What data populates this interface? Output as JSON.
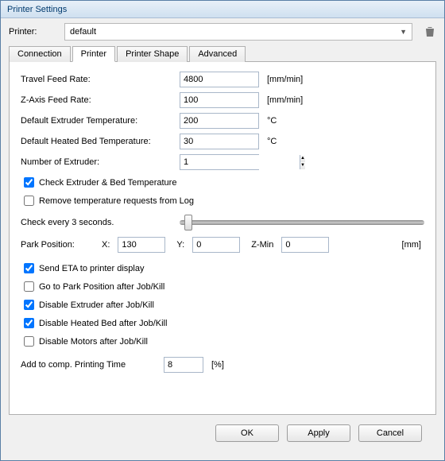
{
  "window": {
    "title": "Printer Settings"
  },
  "header": {
    "printer_label": "Printer:",
    "printer_value": "default"
  },
  "tabs": {
    "items": [
      {
        "label": "Connection"
      },
      {
        "label": "Printer"
      },
      {
        "label": "Printer Shape"
      },
      {
        "label": "Advanced"
      }
    ],
    "active_index": 1
  },
  "fields": {
    "travel_feed_rate": {
      "label": "Travel Feed Rate:",
      "value": "4800",
      "unit": "[mm/min]"
    },
    "z_axis_feed_rate": {
      "label": "Z-Axis Feed Rate:",
      "value": "100",
      "unit": "[mm/min]"
    },
    "default_extruder_temp": {
      "label": "Default Extruder Temperature:",
      "value": "200",
      "unit": "°C"
    },
    "default_bed_temp": {
      "label": "Default Heated Bed Temperature:",
      "value": "30",
      "unit": "°C"
    },
    "num_extruder": {
      "label": "Number of Extruder:",
      "value": "1"
    }
  },
  "checks": {
    "check_temp": {
      "label": "Check Extruder & Bed Temperature",
      "checked": true
    },
    "remove_log": {
      "label": "Remove temperature requests from Log",
      "checked": false
    }
  },
  "slider": {
    "label": "Check every 3 seconds."
  },
  "park": {
    "label": "Park Position:",
    "x_label": "X:",
    "x_value": "130",
    "y_label": "Y:",
    "y_value": "0",
    "zmin_label": "Z-Min",
    "zmin_value": "0",
    "unit": "[mm]"
  },
  "post_checks": {
    "send_eta": {
      "label": "Send ETA to printer display",
      "checked": true
    },
    "go_park": {
      "label": "Go to Park Position after Job/Kill",
      "checked": false
    },
    "disable_extruder": {
      "label": "Disable Extruder after Job/Kill",
      "checked": true
    },
    "disable_bed": {
      "label": "Disable Heated Bed after Job/Kill",
      "checked": true
    },
    "disable_motors": {
      "label": "Disable Motors after Job/Kill",
      "checked": false
    }
  },
  "comp_time": {
    "label": "Add to comp. Printing Time",
    "value": "8",
    "unit": "[%]"
  },
  "buttons": {
    "ok": "OK",
    "apply": "Apply",
    "cancel": "Cancel"
  }
}
